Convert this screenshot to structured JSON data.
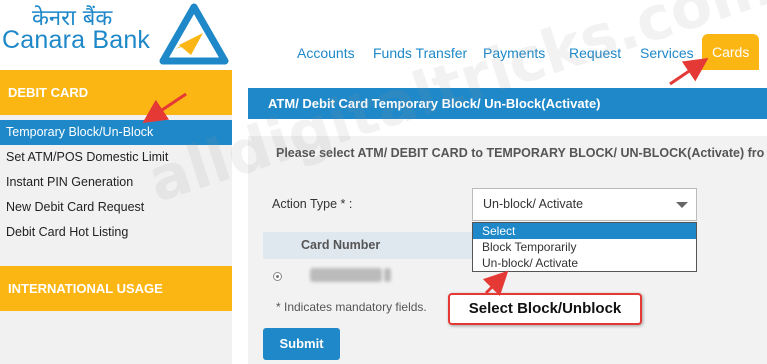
{
  "brand": {
    "hindi_name": "केनरा बैंक",
    "english_name": "Canara Bank",
    "brand_color": "#1e88c9",
    "accent_color": "#fcb614"
  },
  "nav": {
    "items": [
      {
        "label": "Accounts"
      },
      {
        "label": "Funds Transfer"
      },
      {
        "label": "Payments"
      },
      {
        "label": "Request"
      },
      {
        "label": "Services"
      },
      {
        "label": "Cards"
      }
    ],
    "active": "Cards"
  },
  "sidebar": {
    "section1_title": "DEBIT CARD",
    "items": [
      {
        "label": "Temporary Block/Un-Block"
      },
      {
        "label": "Set ATM/POS Domestic Limit"
      },
      {
        "label": "Instant PIN Generation"
      },
      {
        "label": "New Debit Card Request"
      },
      {
        "label": "Debit Card Hot Listing"
      }
    ],
    "active": "Temporary Block/Un-Block",
    "section2_title": "INTERNATIONAL USAGE"
  },
  "main": {
    "title": "ATM/ Debit Card Temporary Block/ Un-Block(Activate)",
    "instruction": "Please select ATM/ DEBIT CARD to TEMPORARY BLOCK/ UN-BLOCK(Activate) fro",
    "action_type_label": "Action Type * :",
    "action_type_value": "Un-block/ Activate",
    "dropdown_options": [
      "Select",
      "Block Temporarily",
      "Un-block/ Activate"
    ],
    "dropdown_highlighted": "Select",
    "card_number_header": "Card Number",
    "card_number_visible_prefix": "4067xxxxxxx",
    "card_number_visible_suffix": "3",
    "mandatory_note": "* Indicates mandatory fields.",
    "submit_label": "Submit"
  },
  "annotation": {
    "callout_text": "Select  Block/Unblock",
    "watermark": "alldigitaltricks.com"
  }
}
